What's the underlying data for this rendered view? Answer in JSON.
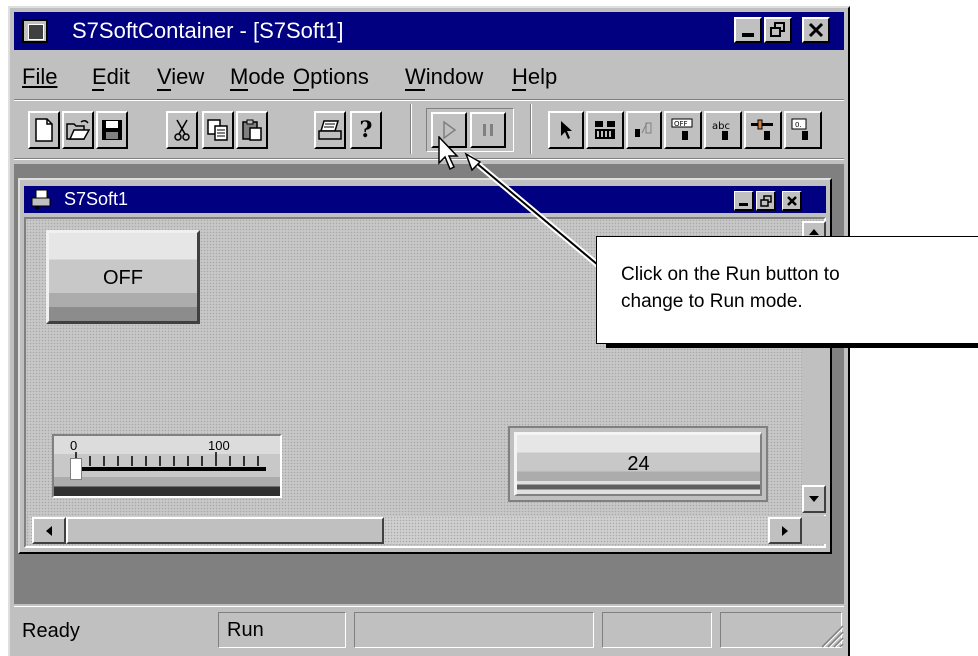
{
  "window": {
    "title": "S7SoftContainer - [S7Soft1]",
    "controls": [
      "minimize",
      "restore",
      "close"
    ]
  },
  "menu": {
    "items": [
      {
        "label": "File",
        "accel": "F"
      },
      {
        "label": "Edit",
        "accel": "E"
      },
      {
        "label": "View",
        "accel": "V"
      },
      {
        "label": "Mode",
        "accel": "M"
      },
      {
        "label": "Options",
        "accel": "O"
      },
      {
        "label": "Window",
        "accel": "W"
      },
      {
        "label": "Help",
        "accel": "H"
      }
    ]
  },
  "toolbar": {
    "buttons": [
      "new-icon",
      "open-icon",
      "save-icon",
      "cut-icon",
      "copy-icon",
      "paste-icon",
      "print-icon",
      "help-icon",
      "run-icon",
      "pause-icon",
      "pointer-icon",
      "tools-icon",
      "io-icon",
      "switch-icon",
      "text-icon",
      "slider-icon",
      "display-icon"
    ]
  },
  "child": {
    "title": "S7Soft1"
  },
  "content": {
    "off_button_label": "OFF",
    "slider": {
      "min_label": "0",
      "max_label": "100",
      "value": 0
    },
    "display_value": "24"
  },
  "callout": {
    "text_line1": "Click on the Run button to",
    "text_line2": "change to Run mode."
  },
  "status": {
    "ready": "Ready",
    "mode": "Run"
  }
}
